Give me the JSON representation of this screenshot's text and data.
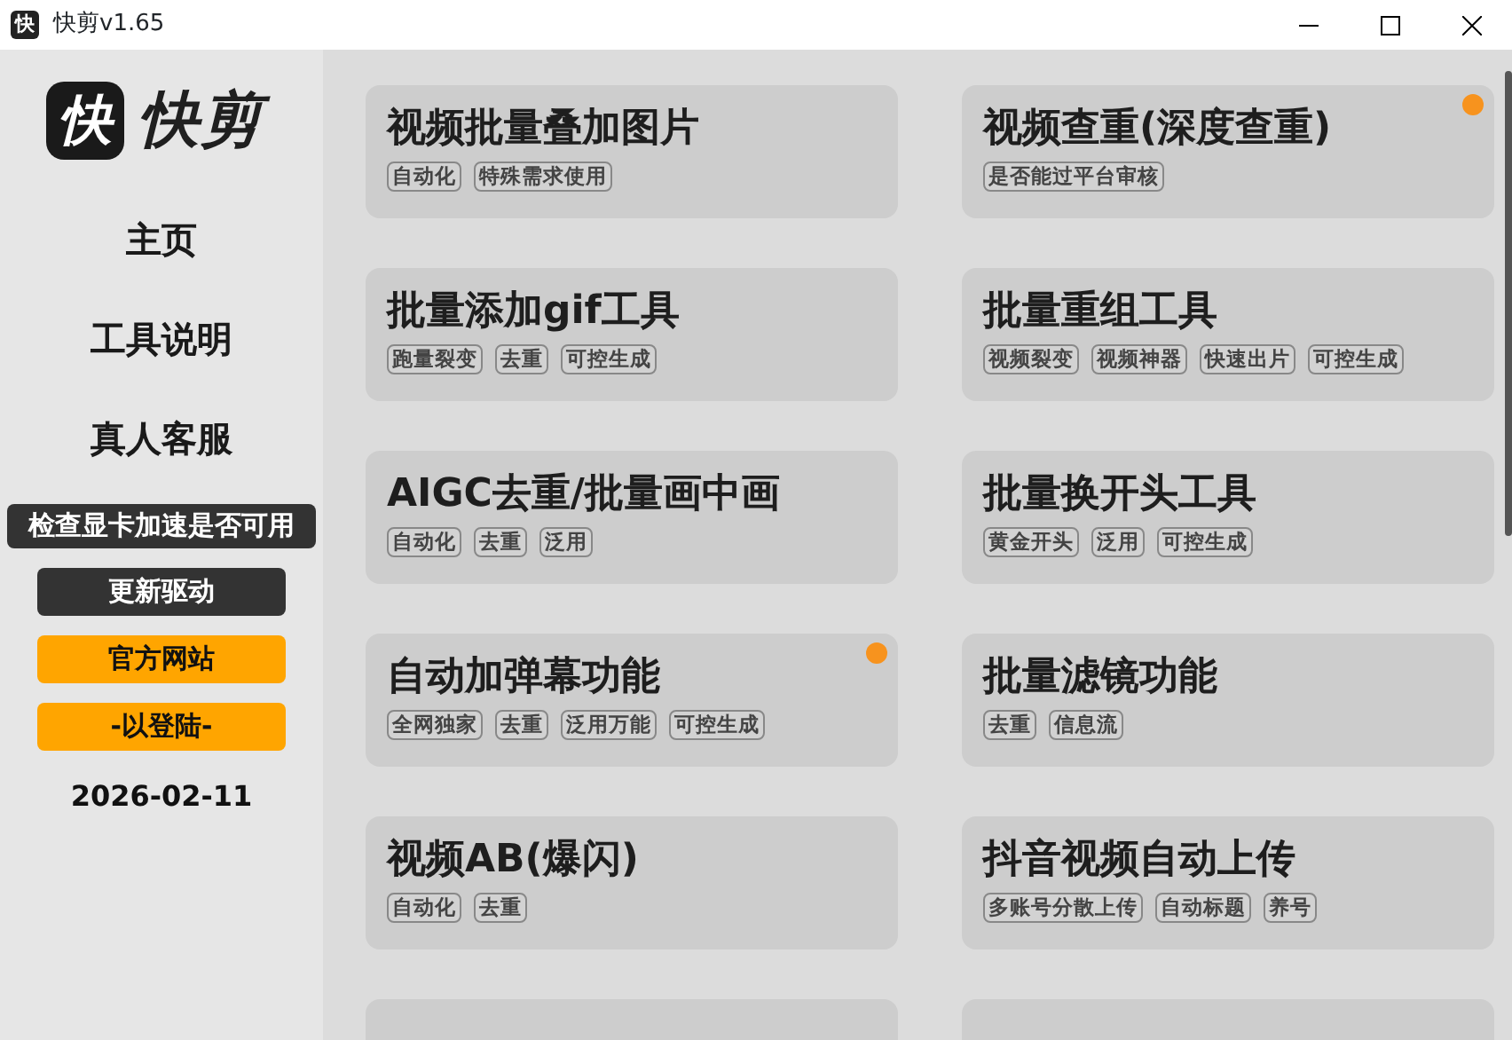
{
  "window": {
    "icon_text": "快",
    "title": "快剪v1.65"
  },
  "sidebar": {
    "logo_text": "快剪",
    "logo_mark": "快",
    "nav": [
      {
        "label": "主页"
      },
      {
        "label": "工具说明"
      },
      {
        "label": "真人客服"
      }
    ],
    "buttons": [
      {
        "label": "检查显卡加速是否可用",
        "kind": "dark-wide"
      },
      {
        "label": "更新驱动",
        "kind": "dark"
      },
      {
        "label": "官方网站",
        "kind": "orange"
      },
      {
        "label": "-以登陆-",
        "kind": "orange"
      }
    ],
    "date": "2026-02-11"
  },
  "tools": [
    {
      "title": "视频批量叠加图片",
      "tags": [
        "自动化",
        "特殊需求使用"
      ],
      "new": false
    },
    {
      "title": "视频查重(深度查重)",
      "tags": [
        "是否能过平台审核"
      ],
      "new": true
    },
    {
      "title": "批量添加gif工具",
      "tags": [
        "跑量裂变",
        "去重",
        "可控生成"
      ],
      "new": false
    },
    {
      "title": "批量重组工具",
      "tags": [
        "视频裂变",
        "视频神器",
        "快速出片",
        "可控生成"
      ],
      "new": false
    },
    {
      "title": "AIGC去重/批量画中画",
      "tags": [
        "自动化",
        "去重",
        "泛用"
      ],
      "new": false
    },
    {
      "title": "批量换开头工具",
      "tags": [
        "黄金开头",
        "泛用",
        "可控生成"
      ],
      "new": false
    },
    {
      "title": "自动加弹幕功能",
      "tags": [
        "全网独家",
        "去重",
        "泛用万能",
        "可控生成"
      ],
      "new": true
    },
    {
      "title": "批量滤镜功能",
      "tags": [
        "去重",
        "信息流"
      ],
      "new": false
    },
    {
      "title": "视频AB(爆闪)",
      "tags": [
        "自动化",
        "去重"
      ],
      "new": false
    },
    {
      "title": "抖音视频自动上传",
      "tags": [
        "多账号分散上传",
        "自动标题",
        "养号"
      ],
      "new": false
    },
    {
      "new": false
    },
    {
      "new": false
    }
  ]
}
